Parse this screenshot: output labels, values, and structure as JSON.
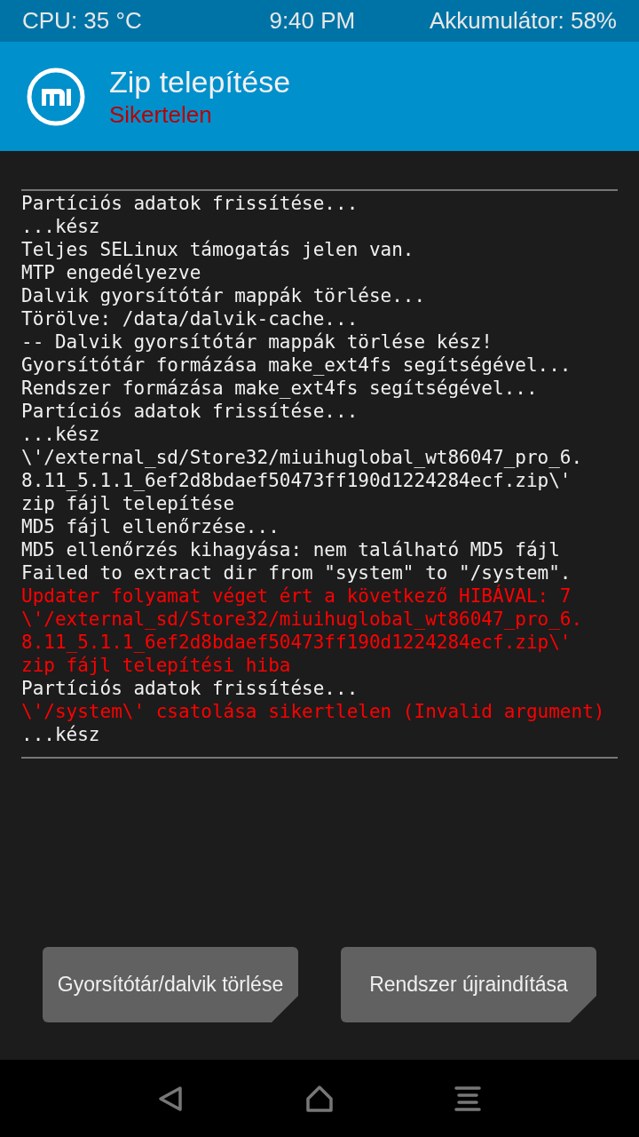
{
  "status_bar": {
    "cpu": "CPU: 35 °C",
    "time": "9:40 PM",
    "battery": "Akkumulátor: 58%"
  },
  "header": {
    "title": "Zip telepítése",
    "status": "Sikertelen"
  },
  "log": [
    {
      "kind": "info",
      "text": "Partíciós adatok frissítése..."
    },
    {
      "kind": "info",
      "text": "...kész"
    },
    {
      "kind": "info",
      "text": "Teljes SELinux támogatás jelen van."
    },
    {
      "kind": "info",
      "text": "MTP engedélyezve"
    },
    {
      "kind": "info",
      "text": "Dalvik gyorsítótár mappák törlése..."
    },
    {
      "kind": "info",
      "text": "Törölve: /data/dalvik-cache..."
    },
    {
      "kind": "info",
      "text": "-- Dalvik gyorsítótár mappák törlése kész!"
    },
    {
      "kind": "info",
      "text": "Gyorsítótár formázása make_ext4fs segítségével..."
    },
    {
      "kind": "info",
      "text": "Rendszer formázása make_ext4fs segítségével..."
    },
    {
      "kind": "info",
      "text": "Partíciós adatok frissítése..."
    },
    {
      "kind": "info",
      "text": "...kész"
    },
    {
      "kind": "info",
      "text": "\\'/external_sd/Store32/miuihuglobal_wt86047_pro_6."
    },
    {
      "kind": "info",
      "text": "8.11_5.1.1_6ef2d8bdaef50473ff190d1224284ecf.zip\\'"
    },
    {
      "kind": "info",
      "text": "zip fájl telepítése"
    },
    {
      "kind": "info",
      "text": "MD5 fájl ellenőrzése..."
    },
    {
      "kind": "info",
      "text": "MD5 ellenőrzés kihagyása: nem található MD5 fájl"
    },
    {
      "kind": "info",
      "text": "Failed to extract dir from \"system\" to \"/system\"."
    },
    {
      "kind": "error",
      "text": "Updater folyamat véget ért a következő HIBÁVAL: 7"
    },
    {
      "kind": "error",
      "text": "\\'/external_sd/Store32/miuihuglobal_wt86047_pro_6."
    },
    {
      "kind": "error",
      "text": "8.11_5.1.1_6ef2d8bdaef50473ff190d1224284ecf.zip\\'"
    },
    {
      "kind": "error",
      "text": "zip fájl telepítési hiba"
    },
    {
      "kind": "info",
      "text": "Partíciós adatok frissítése..."
    },
    {
      "kind": "error",
      "text": "\\'/system\\' csatolása sikertlelen (Invalid argument)"
    },
    {
      "kind": "info",
      "text": "...kész"
    }
  ],
  "buttons": [
    "Gyorsítótár/dalvik törlése",
    "Rendszer újraindítása"
  ]
}
